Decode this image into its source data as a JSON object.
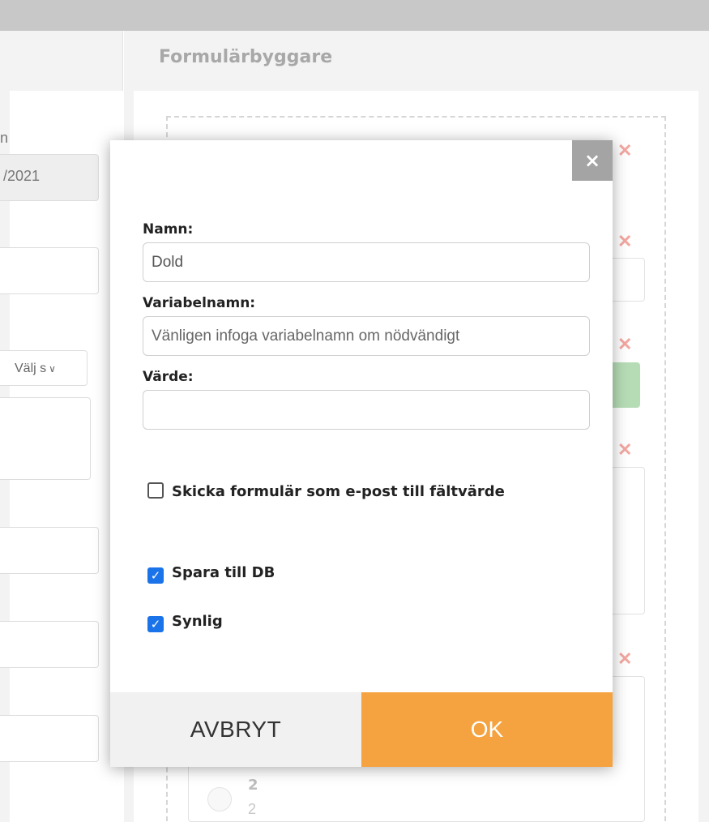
{
  "background": {
    "title": "Formulärbyggare",
    "left_label_fragment": "n",
    "date_fragment": "/2021",
    "select_fragment": "Välj s",
    "radio_value_bold": "2",
    "radio_value": "2"
  },
  "modal": {
    "close_glyph": "×",
    "name_label": "Namn:",
    "name_value": "Dold",
    "varname_label": "Variabelnamn:",
    "varname_placeholder": "Vänligen infoga variabelnamn om nödvändigt",
    "value_label": "Värde:",
    "value_value": "",
    "checkboxes": [
      {
        "label": "Skicka formulär som e-post till fältvärde",
        "checked": false
      },
      {
        "label": "Spara till DB",
        "checked": true
      },
      {
        "label": "Synlig",
        "checked": true
      }
    ],
    "cancel_label": "AVBRYT",
    "ok_label": "OK"
  },
  "colors": {
    "ok_button": "#f4a340",
    "checkbox_checked": "#1a73e8"
  }
}
